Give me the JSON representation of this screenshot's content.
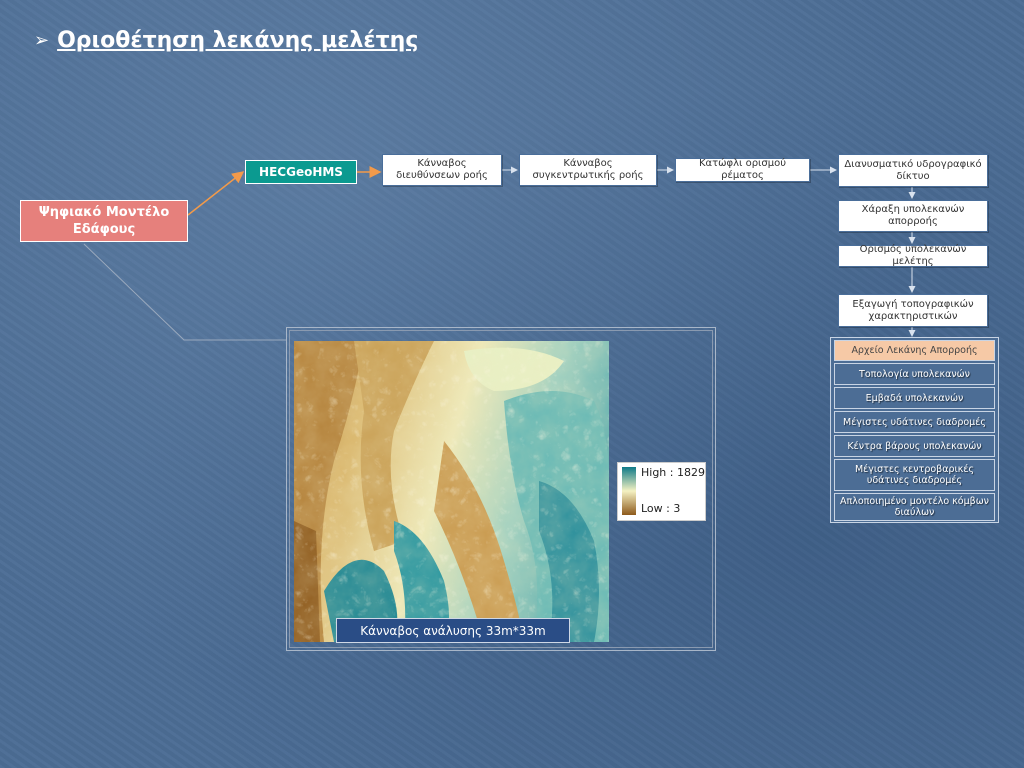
{
  "title": "Οριοθέτηση λεκάνης μελέτης",
  "bullet_icon": "arrow-bullet-icon",
  "dem_box": "Ψηφιακό Μοντέλο Εδάφους",
  "hec_box": "HECGeoHMS",
  "flow_steps": [
    "Κάνναβος διευθύνσεων ροής",
    "Κάνναβος συγκεντρωτικής ροής",
    "Κατώφλι ορισμού ρέματος",
    "Διανυσματικό υδρογραφικό δίκτυο"
  ],
  "vertical_steps": [
    "Χάραξη υπολεκανών απορροής",
    "Ορισμός υπολεκανών μελέτης",
    "Εξαγωγή τοπογραφικών χαρακτηριστικών"
  ],
  "outputs": [
    "Αρχείο Λεκάνης Απορροής",
    "Τοπολογία υπολεκανών",
    "Εμβαδά υπολεκανών",
    "Μέγιστες υδάτινες διαδρομές",
    "Κέντρα βάρους υπολεκανών",
    "Μέγιστες κεντροβαρικές υδάτινες διαδρομές",
    "Απλοποιημένο μοντέλο κόμβων διαύλων"
  ],
  "legend": {
    "high": "High : 1829",
    "low": "Low : 3"
  },
  "map_caption": "Κάνναβος ανάλυσης 33m*33m",
  "colors": {
    "background": "#4c6d95",
    "dem_box": "#e6807c",
    "hec_box": "#0b9a90",
    "highlight": "#f6c9a6",
    "arrow": "#f29a4a"
  }
}
